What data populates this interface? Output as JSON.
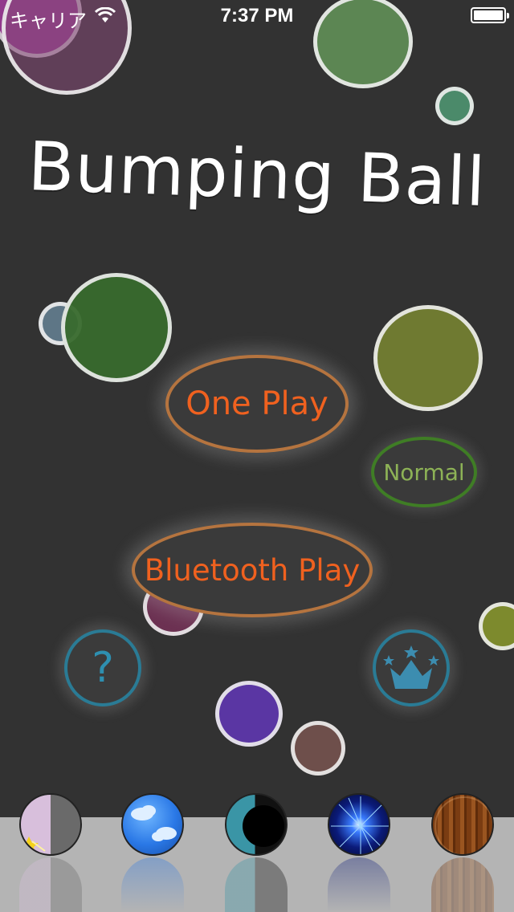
{
  "status_bar": {
    "carrier": "キャリア",
    "time": "7:37 PM",
    "wifi_icon": "wifi-icon",
    "battery_icon": "battery-icon"
  },
  "title": "Bumping Ball",
  "menu": {
    "one_play_label": "One Play",
    "bluetooth_play_label": "Bluetooth Play",
    "difficulty_label": "Normal",
    "help_label": "?",
    "ranking_icon": "crown-icon"
  },
  "themes": [
    {
      "name": "moon-theme",
      "icon": "moon-ball-icon"
    },
    {
      "name": "sky-theme",
      "icon": "cloud-ball-icon"
    },
    {
      "name": "eclipse-theme",
      "icon": "eclipse-ball-icon"
    },
    {
      "name": "space-theme",
      "icon": "burst-ball-icon"
    },
    {
      "name": "wood-theme",
      "icon": "wood-ball-icon"
    }
  ],
  "colors": {
    "background": "#323232",
    "button_text": "#f0611f",
    "button_border": "#b5743f",
    "normal_text": "#8db256",
    "accent_blue": "#2e8fb0",
    "shelf": "#b4b4b4"
  }
}
